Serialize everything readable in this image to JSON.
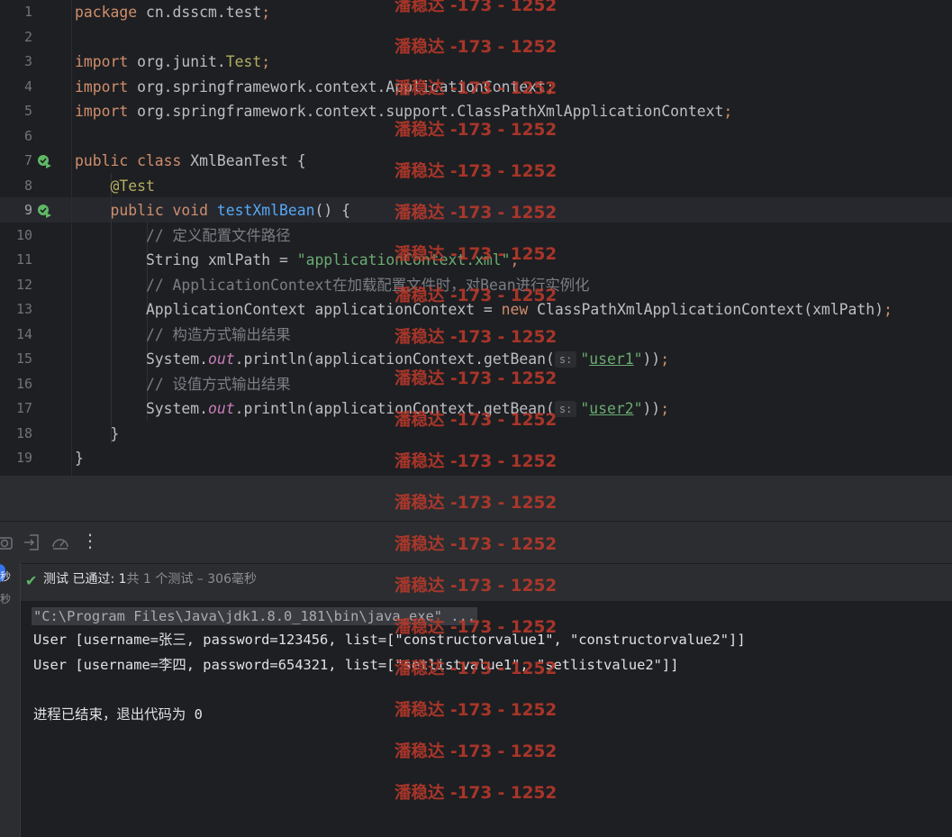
{
  "editor": {
    "lines": [
      {
        "n": "1",
        "tokens": [
          [
            "kw",
            "package "
          ],
          [
            "cls",
            "cn.dsscm.test"
          ],
          [
            "semi",
            ";"
          ]
        ]
      },
      {
        "n": "2",
        "tokens": []
      },
      {
        "n": "3",
        "tokens": [
          [
            "kw",
            "import "
          ],
          [
            "cls",
            "org.junit."
          ],
          [
            "ann",
            "Test"
          ],
          [
            "semi",
            ";"
          ]
        ]
      },
      {
        "n": "4",
        "tokens": [
          [
            "kw",
            "import "
          ],
          [
            "cls",
            "org.springframework.context.ApplicationContext"
          ],
          [
            "semi",
            ";"
          ]
        ]
      },
      {
        "n": "5",
        "tokens": [
          [
            "kw",
            "import "
          ],
          [
            "cls",
            "org.springframework.context.support.ClassPathXmlApplicationContext"
          ],
          [
            "semi",
            ";"
          ]
        ]
      },
      {
        "n": "6",
        "tokens": []
      },
      {
        "n": "7",
        "run": true,
        "tokens": [
          [
            "kw",
            "public class "
          ],
          [
            "cls",
            "XmlBeanTest {"
          ]
        ]
      },
      {
        "n": "8",
        "tokens": [
          [
            "cls",
            "    "
          ],
          [
            "ann",
            "@Test"
          ]
        ]
      },
      {
        "n": "9",
        "run": true,
        "active": true,
        "tokens": [
          [
            "cls",
            "    "
          ],
          [
            "kw",
            "public void "
          ],
          [
            "fn-decl",
            "testXmlBean"
          ],
          [
            "cls",
            "() {"
          ]
        ]
      },
      {
        "n": "10",
        "tokens": [
          [
            "cls",
            "        "
          ],
          [
            "cmt",
            "// 定义配置文件路径"
          ]
        ]
      },
      {
        "n": "11",
        "tokens": [
          [
            "cls",
            "        String xmlPath = "
          ],
          [
            "str",
            "\"applicationContext.xml\""
          ],
          [
            "semi",
            ";"
          ]
        ]
      },
      {
        "n": "12",
        "tokens": [
          [
            "cls",
            "        "
          ],
          [
            "cmt",
            "// ApplicationContext在加载配置文件时，对Bean进行实例化"
          ]
        ]
      },
      {
        "n": "13",
        "tokens": [
          [
            "cls",
            "        ApplicationContext applicationContext = "
          ],
          [
            "kw",
            "new "
          ],
          [
            "cls",
            "ClassPathXmlApplicationContext(xmlPath)"
          ],
          [
            "semi",
            ";"
          ]
        ]
      },
      {
        "n": "14",
        "tokens": [
          [
            "cls",
            "        "
          ],
          [
            "cmt",
            "// 构造方式输出结果"
          ]
        ]
      },
      {
        "n": "15",
        "tokens": [
          [
            "cls",
            "        System."
          ],
          [
            "static",
            "out"
          ],
          [
            "cls",
            ".println(applicationContext.getBean("
          ],
          [
            "hint",
            "s:"
          ],
          [
            "str",
            "\""
          ],
          [
            "stru",
            "user1"
          ],
          [
            "str",
            "\""
          ],
          [
            "cls",
            "))"
          ],
          [
            "semi",
            ";"
          ]
        ]
      },
      {
        "n": "16",
        "tokens": [
          [
            "cls",
            "        "
          ],
          [
            "cmt",
            "// 设值方式输出结果"
          ]
        ]
      },
      {
        "n": "17",
        "tokens": [
          [
            "cls",
            "        System."
          ],
          [
            "static",
            "out"
          ],
          [
            "cls",
            ".println(applicationContext.getBean("
          ],
          [
            "hint",
            "s:"
          ],
          [
            "str",
            "\""
          ],
          [
            "stru",
            "user2"
          ],
          [
            "str",
            "\""
          ],
          [
            "cls",
            "))"
          ],
          [
            "semi",
            ";"
          ]
        ]
      },
      {
        "n": "18",
        "tokens": [
          [
            "cls",
            "    }"
          ]
        ]
      },
      {
        "n": "19",
        "tokens": [
          [
            "cls",
            "}"
          ]
        ]
      }
    ]
  },
  "toolbar": {
    "icons": [
      "camera-icon",
      "export-icon",
      "speedometer-icon",
      "more-vertical-icon"
    ],
    "more_label": "⋮"
  },
  "status": {
    "label": "测试 已通过: ",
    "passed": "1",
    "summary": "共 1 个测试 – 306毫秒"
  },
  "left_tree": {
    "time1": "秒",
    "time2": "秒"
  },
  "console": {
    "cmd": "\"C:\\Program Files\\Java\\jdk1.8.0_181\\bin\\java.exe\" ...",
    "out1": "User [username=张三, password=123456, list=[\"constructorvalue1\", \"constructorvalue2\"]]",
    "out2": "User [username=李四, password=654321, list=[\"setlistvalue1\", \"setlistvalue2\"]]",
    "exit": "进程已结束，退出代码为 0"
  },
  "watermark": {
    "text": "潘稳达 -173 - 1252",
    "color": "#c0392b"
  },
  "colors": {
    "background": "#1e1f22",
    "panel": "#2b2d30",
    "keyword": "#cf8e6d",
    "string": "#6aab73",
    "comment": "#7a7e85",
    "success": "#5fb865"
  }
}
